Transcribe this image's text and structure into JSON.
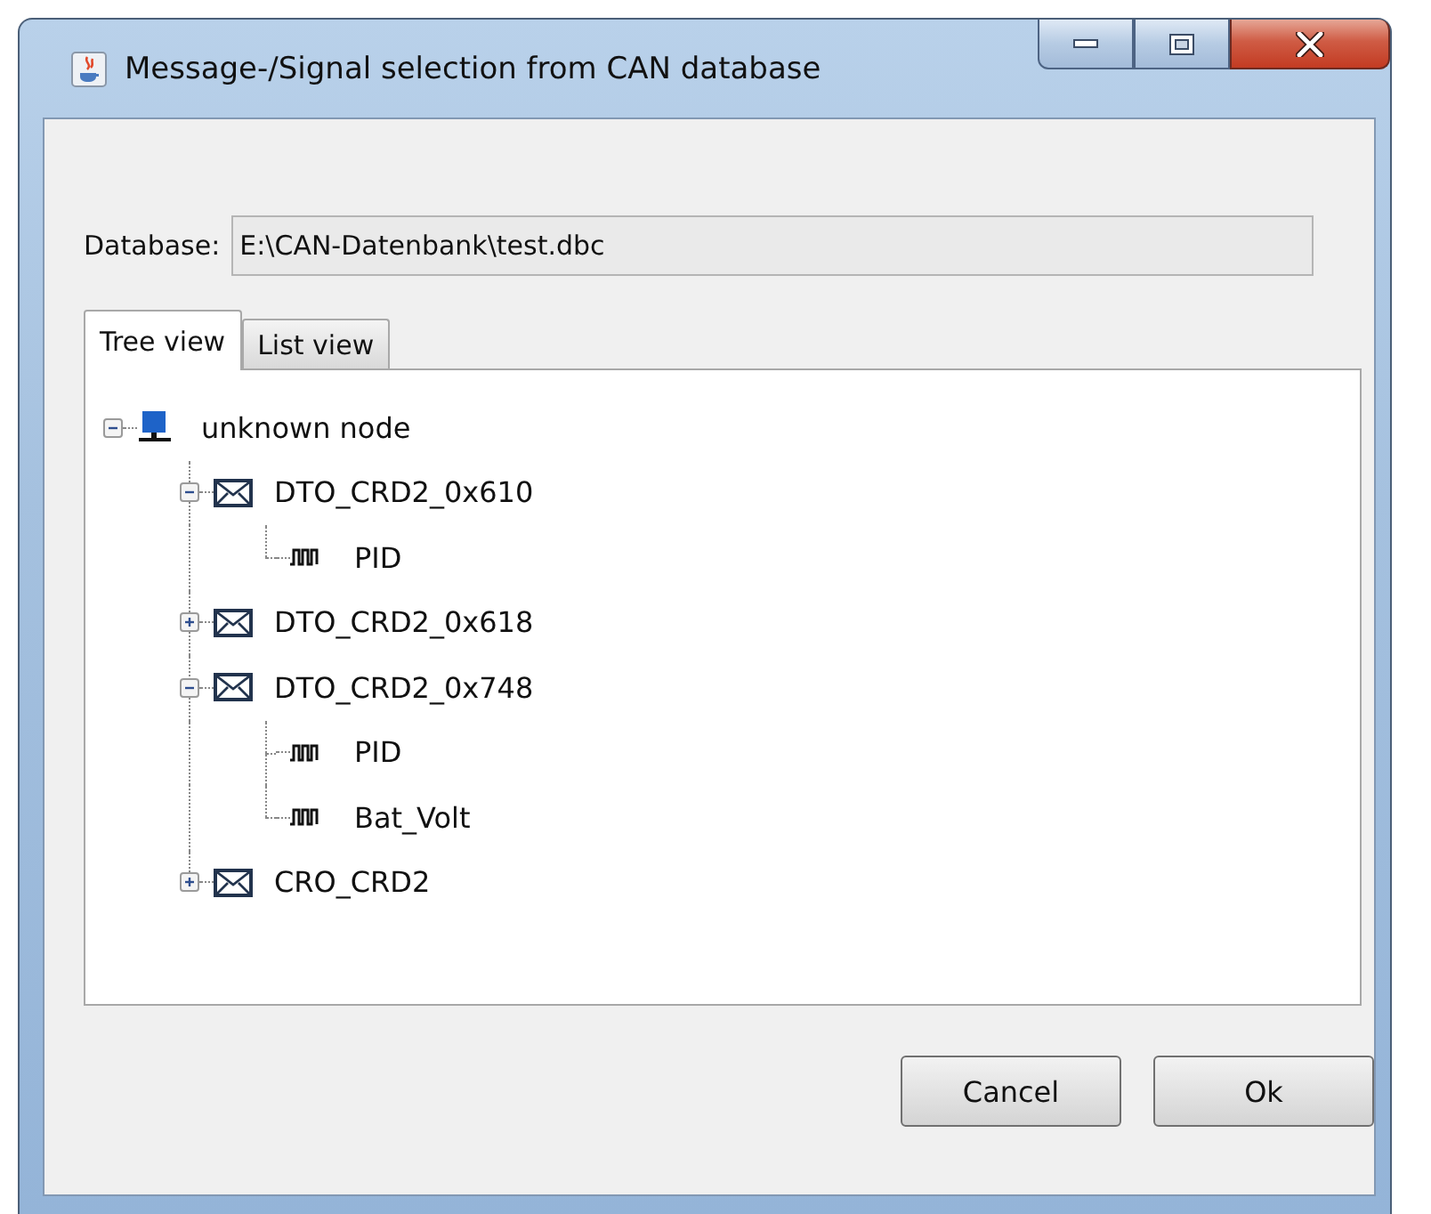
{
  "window": {
    "title": "Message-/Signal selection from CAN database"
  },
  "database": {
    "label": "Database:",
    "value": "E:\\CAN-Datenbank\\test.dbc"
  },
  "tabs": [
    {
      "label": "Tree view",
      "selected": true
    },
    {
      "label": "List view",
      "selected": false
    }
  ],
  "tree": [
    {
      "kind": "node",
      "label": "unknown node",
      "expanded": true,
      "children": [
        {
          "kind": "message",
          "label": "DTO_CRD2_0x610",
          "expanded": true,
          "children": [
            {
              "kind": "signal",
              "label": "PID"
            }
          ]
        },
        {
          "kind": "message",
          "label": "DTO_CRD2_0x618",
          "expanded": false
        },
        {
          "kind": "message",
          "label": "DTO_CRD2_0x748",
          "expanded": true,
          "children": [
            {
              "kind": "signal",
              "label": "PID"
            },
            {
              "kind": "signal",
              "label": "Bat_Volt"
            }
          ]
        },
        {
          "kind": "message",
          "label": "CRO_CRD2",
          "expanded": false
        }
      ]
    }
  ],
  "buttons": [
    {
      "label": "Cancel"
    },
    {
      "label": "Ok"
    }
  ]
}
